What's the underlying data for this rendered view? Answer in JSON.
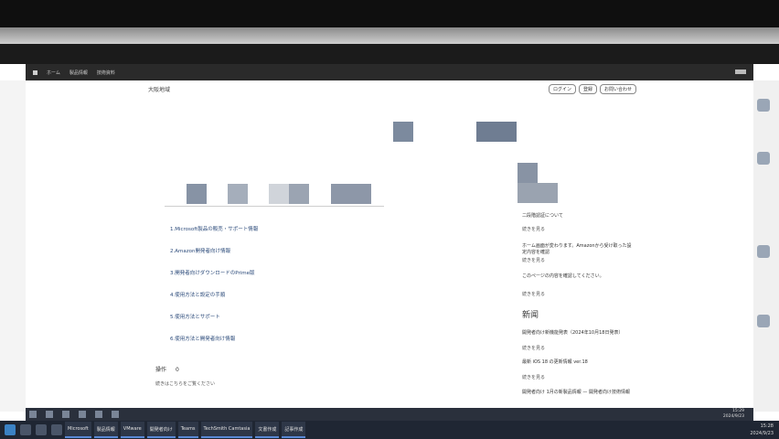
{
  "nav": {
    "items": [
      "ホーム",
      "製品情報",
      "技術資料"
    ]
  },
  "breadcrumb": "大阪地域",
  "top_buttons": [
    "ログイン",
    "登録",
    "お問い合わせ"
  ],
  "links": [
    "1.Microsoft製品の販売・サポート情報",
    "2.Amazon開発者向け情報",
    "3.開発者向けダウンロードのPrime版",
    "4.使用方法と設定の手順",
    "5.使用方法とサポート",
    "6.使用方法と開発者向け情報"
  ],
  "sidebar": {
    "section1_title": "二段階認証について",
    "more": "続きを見る",
    "item2": "ホーム画面が変わります。Amazonから受け取った設定内容を確認",
    "item3": "このページの内容を確認してください。",
    "news_title": "新闻",
    "news1": "開発者向け新機能発表（2024年10月18日発表）",
    "news2": "最新 iOS 18 の更新情報 ver.18",
    "news3": "開発者向け 1月の新製品情報 — 開発者向け技術情報"
  },
  "bottom": {
    "label": "操作",
    "count": "0",
    "note": "続きはこちらをご覧ください"
  },
  "taskbar": {
    "apps": [
      "Microsoft",
      "製品情報",
      "VMware",
      "開発者向け",
      "Teams",
      "TechSmith Camtasia",
      "文書作成",
      "記事作成"
    ],
    "time": "15:28",
    "date": "2024/9/23"
  },
  "inner_clock": {
    "time": "15:29",
    "date": "2024/9/23"
  }
}
